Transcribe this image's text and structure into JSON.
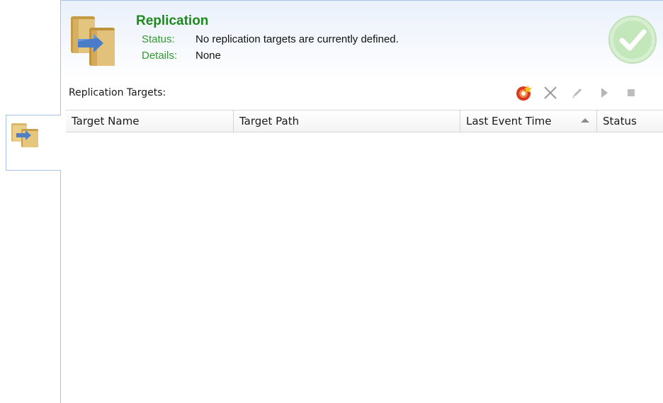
{
  "header": {
    "title": "Replication",
    "status_label": "Status:",
    "status_value": "No replication targets are currently defined.",
    "details_label": "Details:",
    "details_value": "None",
    "icon": "replication-folders-icon",
    "status_indicator": "check-icon"
  },
  "targets": {
    "label": "Replication Targets:",
    "toolbar": [
      {
        "name": "add-target-button",
        "icon": "add-target-icon"
      },
      {
        "name": "delete-target-button",
        "icon": "close-icon"
      },
      {
        "name": "edit-target-button",
        "icon": "pencil-icon"
      },
      {
        "name": "start-button",
        "icon": "play-icon"
      },
      {
        "name": "stop-button",
        "icon": "stop-icon"
      }
    ],
    "columns": [
      "Target Name",
      "Target Path",
      "Last Event Time",
      "Status"
    ],
    "sorted_column": "Last Event Time",
    "rows": []
  },
  "sidebar": {
    "tab_icon": "replication-folders-icon"
  },
  "colors": {
    "title_green": "#1d8a1d",
    "label_green": "#2f9a2f",
    "border_blue": "#a9c4e6",
    "add_icon_red": "#d9381e"
  }
}
